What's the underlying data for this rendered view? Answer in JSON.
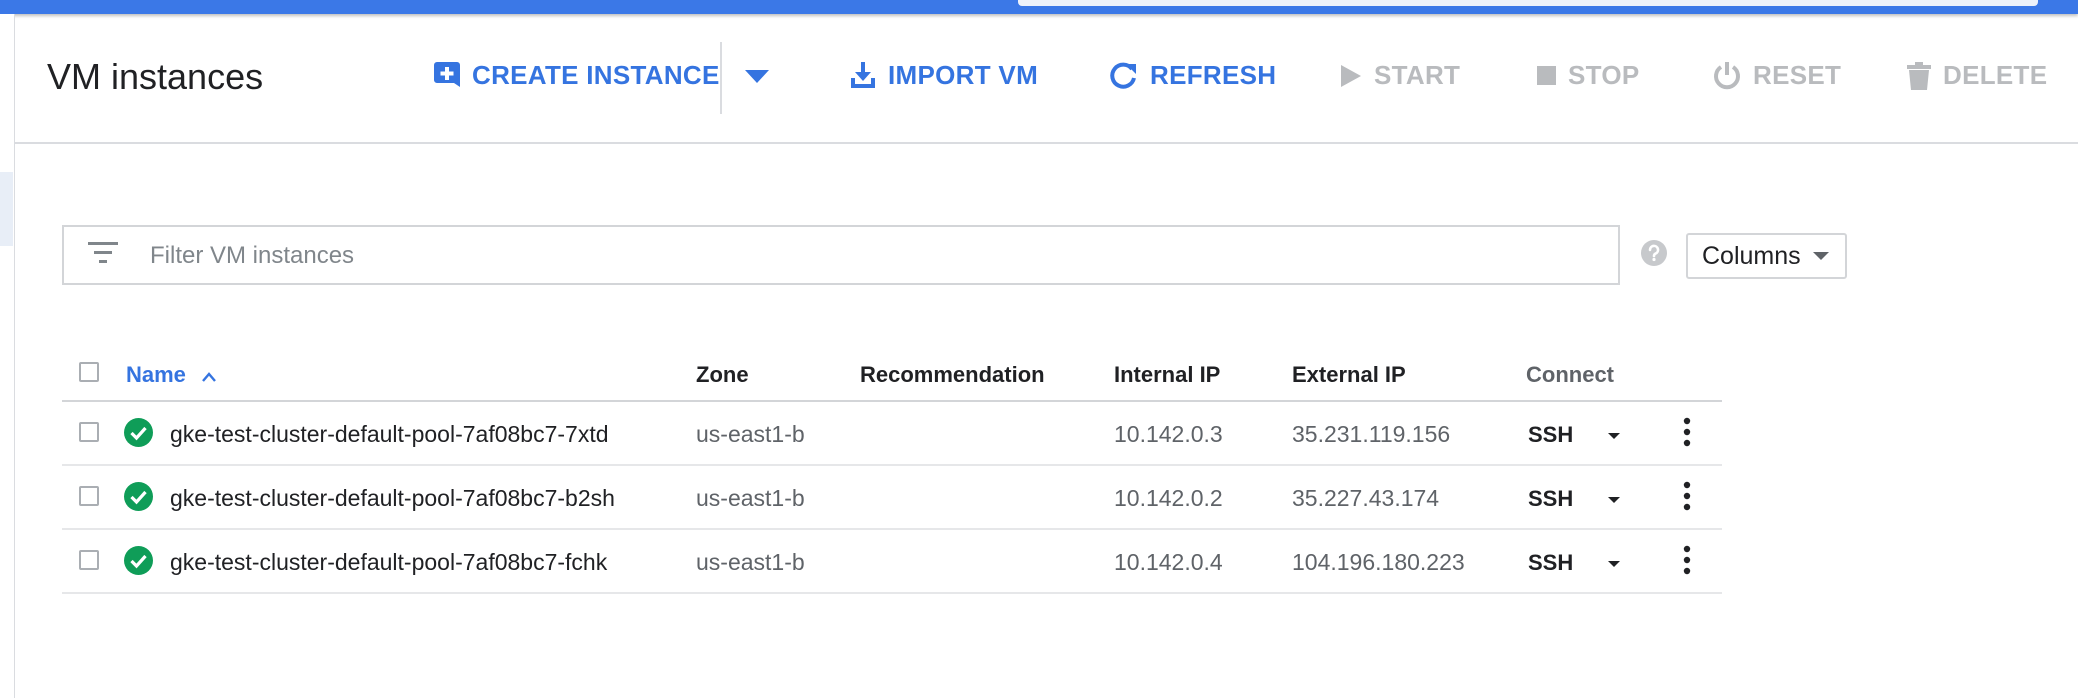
{
  "header": {
    "title": "VM instances",
    "toolbar": {
      "create_instance": "CREATE INSTANCE",
      "import_vm": "IMPORT VM",
      "refresh": "REFRESH",
      "start": "START",
      "stop": "STOP",
      "reset": "RESET",
      "delete": "DELETE"
    }
  },
  "filter": {
    "placeholder": "Filter VM instances",
    "value": ""
  },
  "columns_button": "Columns",
  "table": {
    "headers": {
      "name": "Name",
      "zone": "Zone",
      "recommendation": "Recommendation",
      "internal_ip": "Internal IP",
      "external_ip": "External IP",
      "connect": "Connect"
    },
    "sort": {
      "column": "Name",
      "direction": "ascending"
    },
    "rows": [
      {
        "status": "running",
        "name": "gke-test-cluster-default-pool-7af08bc7-7xtd",
        "zone": "us-east1-b",
        "recommendation": "",
        "internal_ip": "10.142.0.3",
        "external_ip": "35.231.119.156",
        "connect": "SSH"
      },
      {
        "status": "running",
        "name": "gke-test-cluster-default-pool-7af08bc7-b2sh",
        "zone": "us-east1-b",
        "recommendation": "",
        "internal_ip": "10.142.0.2",
        "external_ip": "35.227.43.174",
        "connect": "SSH"
      },
      {
        "status": "running",
        "name": "gke-test-cluster-default-pool-7af08bc7-fchk",
        "zone": "us-east1-b",
        "recommendation": "",
        "internal_ip": "10.142.0.4",
        "external_ip": "104.196.180.223",
        "connect": "SSH"
      }
    ]
  },
  "icons": {
    "create": "add-box-icon",
    "expand": "chevron-down-icon",
    "import": "download-icon",
    "refresh": "refresh-icon",
    "start": "play-icon",
    "stop": "stop-icon",
    "reset": "power-icon",
    "delete": "trash-icon",
    "filter": "filter-list-icon",
    "help": "help-icon",
    "sort": "sort-ascending-icon",
    "status": "check-circle-icon",
    "more": "more-vert-icon"
  },
  "colors": {
    "brand_bar": "#3b78e7",
    "accent": "#3574e0",
    "disabled": "#b9bbbe",
    "status_ok": "#0f9d58"
  }
}
